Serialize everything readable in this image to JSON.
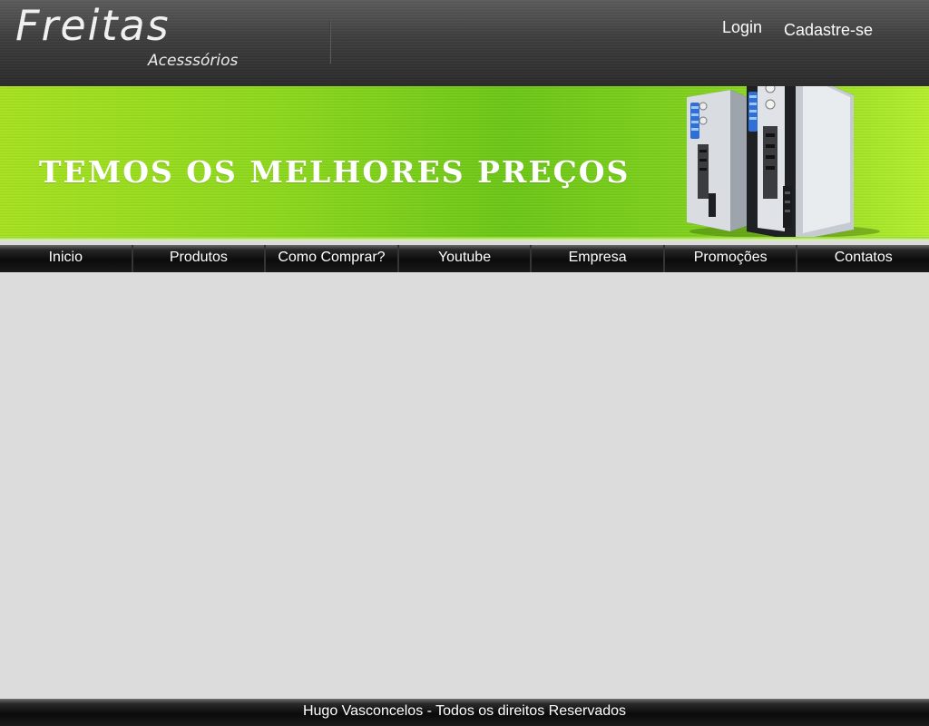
{
  "header": {
    "brand_name": "Freitas",
    "brand_subtitle": "Acesssórios",
    "login_label": "Login",
    "register_label": "Cadastre-se"
  },
  "banner": {
    "headline": "TEMOS OS MELHORES PREÇOS"
  },
  "nav": {
    "items": [
      {
        "label": "Inicio"
      },
      {
        "label": "Produtos"
      },
      {
        "label": "Como Comprar?"
      },
      {
        "label": "Youtube"
      },
      {
        "label": "Empresa"
      },
      {
        "label": "Promoções"
      },
      {
        "label": "Contatos"
      }
    ]
  },
  "footer": {
    "text": "Hugo Vasconcelos - Todos os direitos Reservados"
  },
  "colors": {
    "banner_green": "#8cd81a",
    "header_dark": "#3d3d3d",
    "page_background": "#dcdcdc"
  }
}
